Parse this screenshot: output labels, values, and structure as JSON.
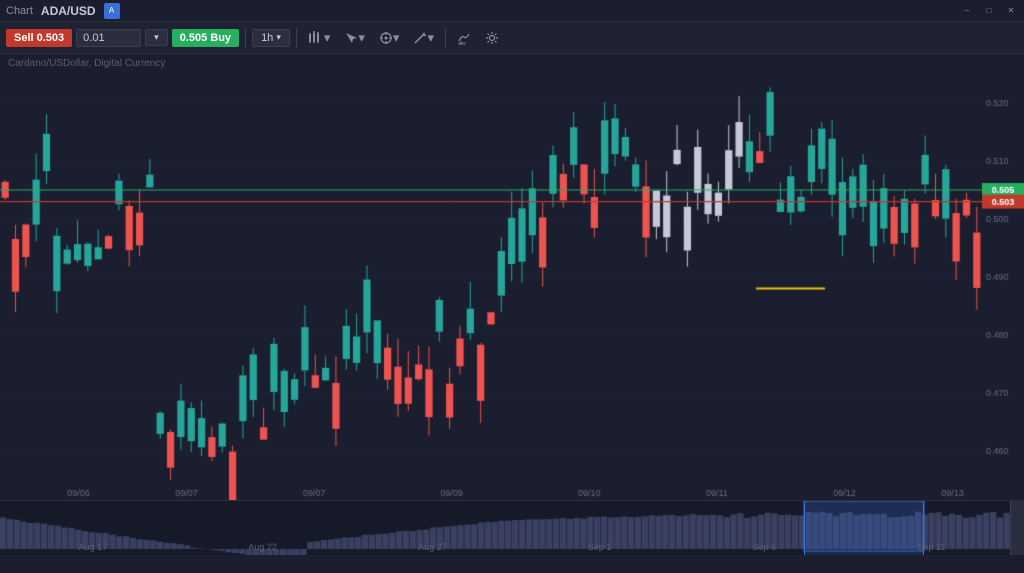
{
  "titleBar": {
    "app": "Chart",
    "pair": "ADA/USD",
    "iconLabel": "A",
    "minusBtn": "–",
    "maxBtn": "□",
    "closeBtn": "✕"
  },
  "toolbar": {
    "sellLabel": "Sell 0.503",
    "buyLabel": "0.505 Buy",
    "quantity": "0.01",
    "timeframe": "1h",
    "tool1": "⑆",
    "tool2": "↖",
    "tool3": "⊙",
    "tool4": "✏",
    "tool5": "⚗",
    "tool6": "⚙"
  },
  "chart": {
    "subtitle": "Cardano/USDollar, Digital Currency",
    "priceHigh": "0.520",
    "priceMid": "0.510",
    "priceCurrent": "0.505",
    "priceSell": "0.503",
    "priceLow1": "0.500",
    "priceLow2": "0.490",
    "priceLow3": "0.480",
    "priceLow4": "0.470",
    "priceLow5": "0.460",
    "greenLineY": 0.505,
    "redLineY": 0.503,
    "yellowSegmentY": 0.488,
    "timeLabels": [
      "09/06",
      "09/07",
      "09/07",
      "09/09",
      "09/10",
      "09/11",
      "09/12",
      "09/13"
    ]
  },
  "miniChart": {
    "labels": [
      "Aug 17",
      "Aug 22",
      "Aug 27",
      "Sep 1",
      "Sep 6",
      "Sep 11"
    ]
  },
  "colors": {
    "background": "#1a1e2e",
    "toolbarBg": "#1e2233",
    "candleGreen": "#26a69a",
    "candleRed": "#ef5350",
    "candleWhite": "#c5c9d8",
    "greenLine": "#27ae60",
    "redLine": "#c0392b",
    "yellowLine": "#f1c40f",
    "gridLine": "#252840",
    "accent": "#3a6fd8"
  }
}
